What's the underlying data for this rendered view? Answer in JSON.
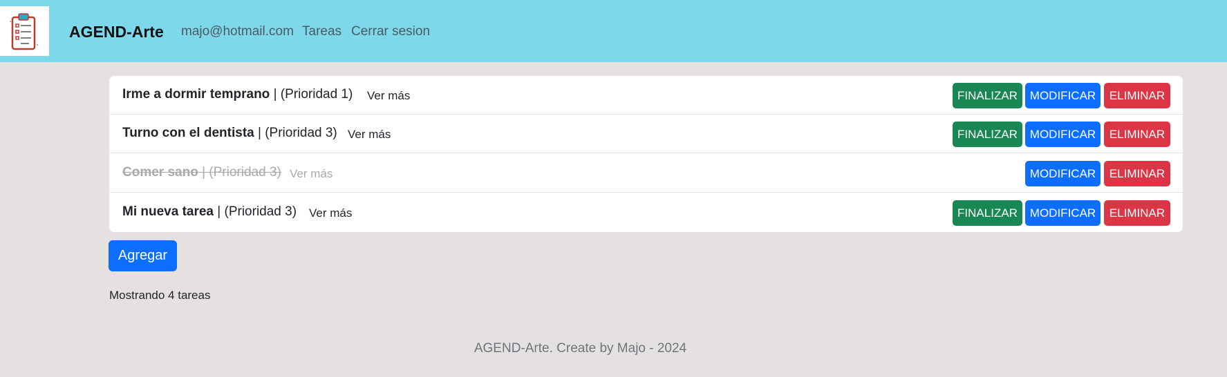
{
  "navbar": {
    "brand": "AGEND-Arte",
    "email": "majo@hotmail.com",
    "tasks_link": "Tareas",
    "logout_link": "Cerrar sesion",
    "background_color": "#7dd8ea"
  },
  "tasks": [
    {
      "title": "Irme a dormir temprano",
      "priority": "| (Prioridad 1)",
      "more": "Ver más",
      "finished": false
    },
    {
      "title": "Turno con el dentista",
      "priority": "| (Prioridad 3)",
      "more": "Ver más",
      "finished": false
    },
    {
      "title": "Comer sano",
      "priority": "| (Prioridad 3)",
      "more": "Ver más",
      "finished": true
    },
    {
      "title": "Mi nueva tarea",
      "priority": "| (Prioridad 3)",
      "more": "Ver más",
      "finished": false
    }
  ],
  "buttons": {
    "finish": "FINALIZAR",
    "modify": "MODIFICAR",
    "delete": "ELIMINAR",
    "add": "Agregar"
  },
  "count_text": "Mostrando 4 tareas",
  "footer": "AGEND-Arte. Create by Majo - 2024",
  "colors": {
    "finish": "#198754",
    "modify": "#0d6efd",
    "delete": "#dc3545",
    "page_background": "#e6e1e1"
  }
}
